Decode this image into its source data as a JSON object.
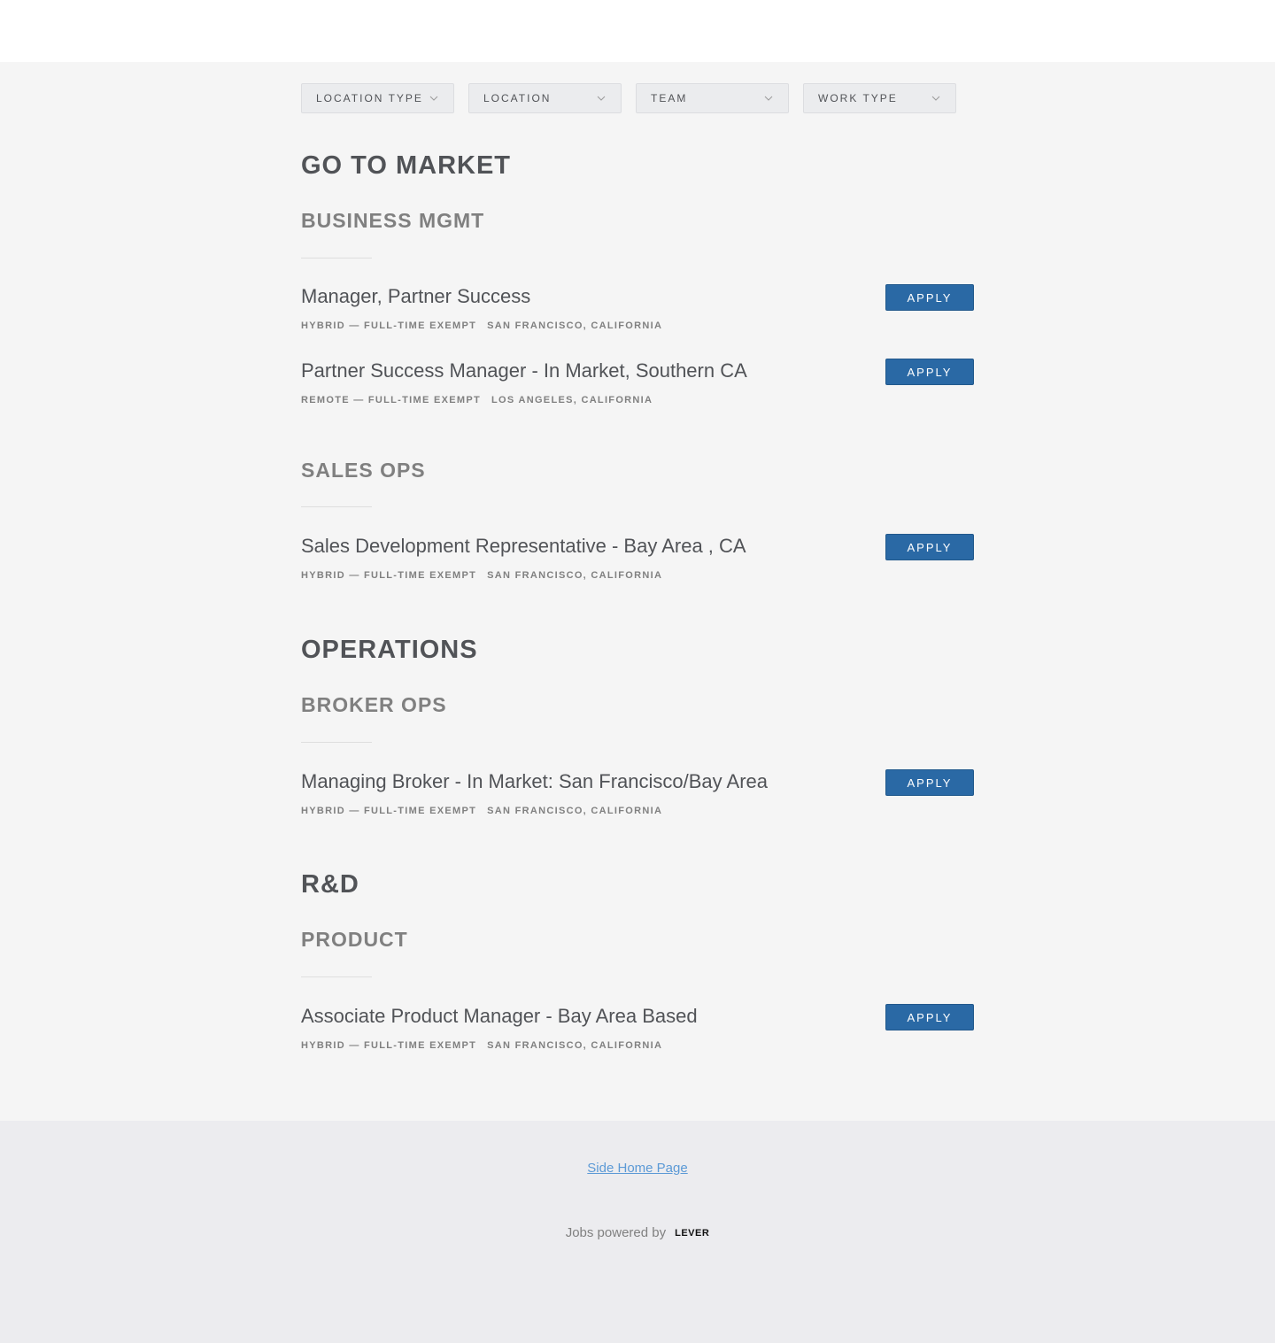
{
  "filters": [
    {
      "label": "LOCATION TYPE",
      "icon": "chevron-down-icon"
    },
    {
      "label": "LOCATION",
      "icon": "chevron-down-icon"
    },
    {
      "label": "TEAM",
      "icon": "chevron-down-icon"
    },
    {
      "label": "WORK TYPE",
      "icon": "chevron-down-icon"
    }
  ],
  "departments": [
    {
      "name": "GO TO MARKET",
      "teams": [
        {
          "name": "BUSINESS MGMT",
          "postings": [
            {
              "title": "Manager, Partner Success",
              "commitment": "HYBRID — FULL-TIME EXEMPT",
              "location": "SAN FRANCISCO, CALIFORNIA",
              "apply_label": "APPLY"
            },
            {
              "title": "Partner Success Manager - In Market, Southern CA",
              "commitment": "REMOTE — FULL-TIME EXEMPT",
              "location": "LOS ANGELES, CALIFORNIA",
              "apply_label": "APPLY"
            }
          ]
        },
        {
          "name": "SALES OPS",
          "postings": [
            {
              "title": "Sales Development Representative - Bay Area , CA",
              "commitment": "HYBRID — FULL-TIME EXEMPT",
              "location": "SAN FRANCISCO, CALIFORNIA",
              "apply_label": "APPLY"
            }
          ]
        }
      ]
    },
    {
      "name": "OPERATIONS",
      "teams": [
        {
          "name": "BROKER OPS",
          "postings": [
            {
              "title": "Managing Broker - In Market: San Francisco/Bay Area",
              "commitment": "HYBRID — FULL-TIME EXEMPT",
              "location": "SAN FRANCISCO, CALIFORNIA",
              "apply_label": "APPLY"
            }
          ]
        }
      ]
    },
    {
      "name": "R&D",
      "teams": [
        {
          "name": "PRODUCT",
          "postings": [
            {
              "title": "Associate Product Manager - Bay Area Based",
              "commitment": "HYBRID — FULL-TIME EXEMPT",
              "location": "SAN FRANCISCO, CALIFORNIA",
              "apply_label": "APPLY"
            }
          ]
        }
      ]
    }
  ],
  "footer": {
    "home_link": "Side Home Page",
    "powered_by": "Jobs powered by",
    "logo_text": "LEVER"
  },
  "colors": {
    "apply_button": "#2a69a5",
    "link": "#5c9ad6",
    "background": "#f5f5f5",
    "footer_background": "#ececef"
  }
}
